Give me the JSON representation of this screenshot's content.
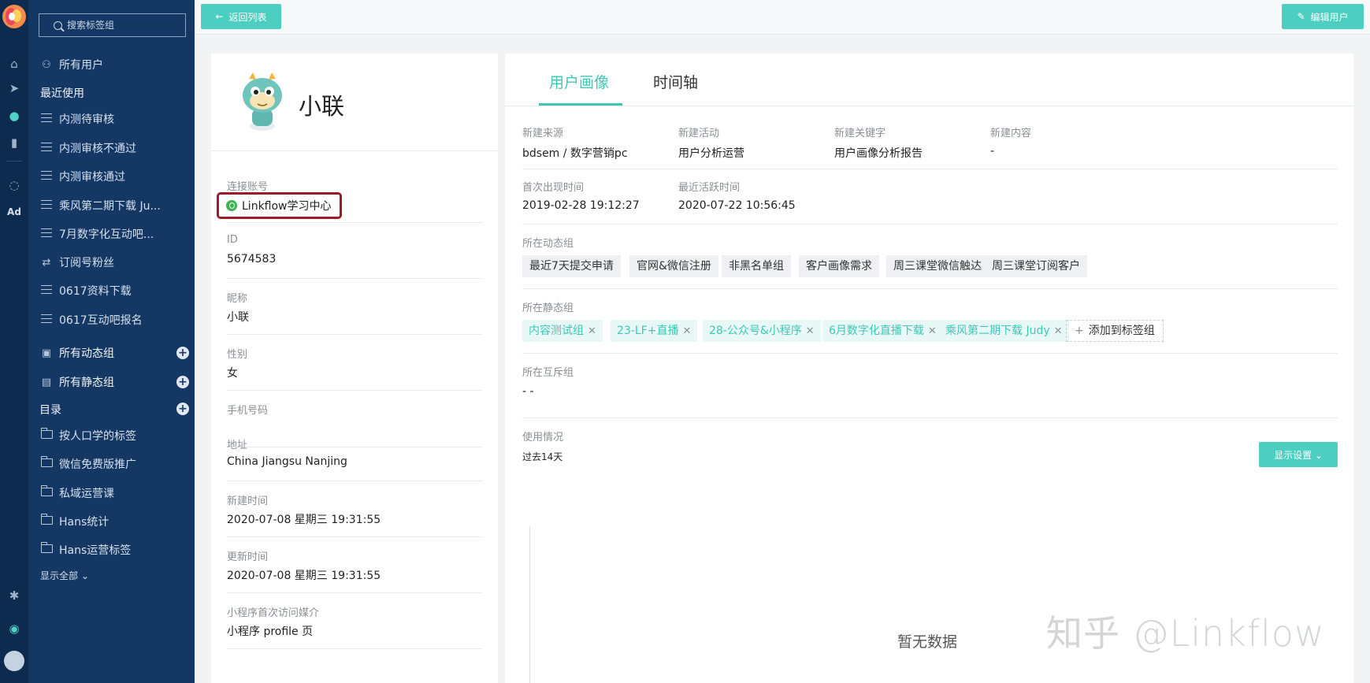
{
  "sidebar": {
    "search_placeholder": "搜索标签组",
    "all_users": "所有用户",
    "recent_heading": "最近使用",
    "recent_items": [
      "内测待审核",
      "内测审核不通过",
      "内测审核通过",
      "乘风第二期下载 Ju...",
      "7月数字化互动吧...",
      "订阅号粉丝",
      "0617资料下载",
      "0617互动吧报名"
    ],
    "dynamic_groups": "所有动态组",
    "static_groups": "所有静态组",
    "catalog": "目录",
    "folders": [
      "按人口学的标签",
      "微信免费版推广",
      "私域运营课",
      "Hans统计",
      "Hans运营标签"
    ],
    "show_all": "显示全部 ⌄"
  },
  "topbar": {
    "back_label": "返回列表",
    "edit_label": "编辑用户"
  },
  "profile": {
    "name": "小联",
    "connected_account_label": "连接账号",
    "connected_account": "Linkflow学习中心",
    "id_label": "ID",
    "id": "5674583",
    "nickname_label": "昵称",
    "nickname": "小联",
    "gender_label": "性别",
    "gender": "女",
    "phone_label": "手机号码",
    "address_label": "地址",
    "address": "China Jiangsu Nanjing",
    "created_label": "新建时间",
    "created": "2020-07-08 星期三 19:31:55",
    "updated_label": "更新时间",
    "updated": "2020-07-08 星期三 19:31:55",
    "miniprogram_label": "小程序首次访问媒介",
    "miniprogram": "小程序 profile 页"
  },
  "tabs": [
    "用户画像",
    "时间轴"
  ],
  "details": {
    "source_label": "新建来源",
    "source": "bdsem / 数字营销pc",
    "campaign_label": "新建活动",
    "campaign": "用户分析运营",
    "keyword_label": "新建关键字",
    "keyword": "用户画像分析报告",
    "content_label": "新建内容",
    "content": "-",
    "first_seen_label": "首次出现时间",
    "first_seen": "2019-02-28 19:12:27",
    "last_active_label": "最近活跃时间",
    "last_active": "2020-07-22 10:56:45",
    "dynamic_label": "所在动态组",
    "dynamic_tags": [
      "最近7天提交申请",
      "官网&微信注册",
      "非黑名单组",
      "客户画像需求",
      "周三课堂微信触达",
      "周三课堂订阅客户"
    ],
    "static_label": "所在静态组",
    "static_tags": [
      "内容测试组",
      "23-LF+直播",
      "28-公众号&小程序",
      "6月数字化直播下载",
      "乘风第二期下载 Judy"
    ],
    "add_tag_label": "添加到标签组",
    "mutex_label": "所在互斥组",
    "mutex": "- -",
    "usage_label": "使用情况",
    "usage_range": "过去14天",
    "display_settings": "显示设置 ⌄",
    "no_data": "暂无数据"
  },
  "watermark": "知乎 @Linkflow"
}
